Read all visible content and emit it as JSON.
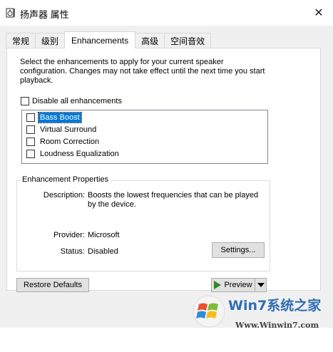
{
  "window": {
    "title": "扬声器 属性",
    "close_glyph": "✕"
  },
  "tabs": [
    {
      "label": "常规",
      "active": false
    },
    {
      "label": "级别",
      "active": false
    },
    {
      "label": "Enhancements",
      "active": true
    },
    {
      "label": "高级",
      "active": false
    },
    {
      "label": "空间音效",
      "active": false
    }
  ],
  "enhancements": {
    "intro_lines": [
      "Select the enhancements to apply for your current speaker",
      "configuration. Changes may not take effect until the next time you start",
      "playback."
    ],
    "disable_all_label": "Disable all enhancements",
    "disable_all_checked": false,
    "items": [
      {
        "label": "Bass Boost",
        "checked": false,
        "selected": true
      },
      {
        "label": "Virtual Surround",
        "checked": false,
        "selected": false
      },
      {
        "label": "Room Correction",
        "checked": false,
        "selected": false
      },
      {
        "label": "Loudness Equalization",
        "checked": false,
        "selected": false
      }
    ]
  },
  "properties": {
    "group_title": "Enhancement Properties",
    "description_label": "Description:",
    "description_lines": [
      "Boosts the lowest frequencies that can be played",
      "by the device."
    ],
    "provider_label": "Provider:",
    "provider_value": "Microsoft",
    "status_label": "Status:",
    "status_value": "Disabled",
    "settings_button": "Settings..."
  },
  "buttons": {
    "restore_defaults": "Restore Defaults",
    "preview": "Preview"
  },
  "watermark": {
    "brand": "Win7系统之家",
    "url": "Www.Winwin7.com"
  },
  "colors": {
    "selection": "#0078d7",
    "play": "#2e8b2e",
    "watermark_blue": "#2f6db5"
  }
}
